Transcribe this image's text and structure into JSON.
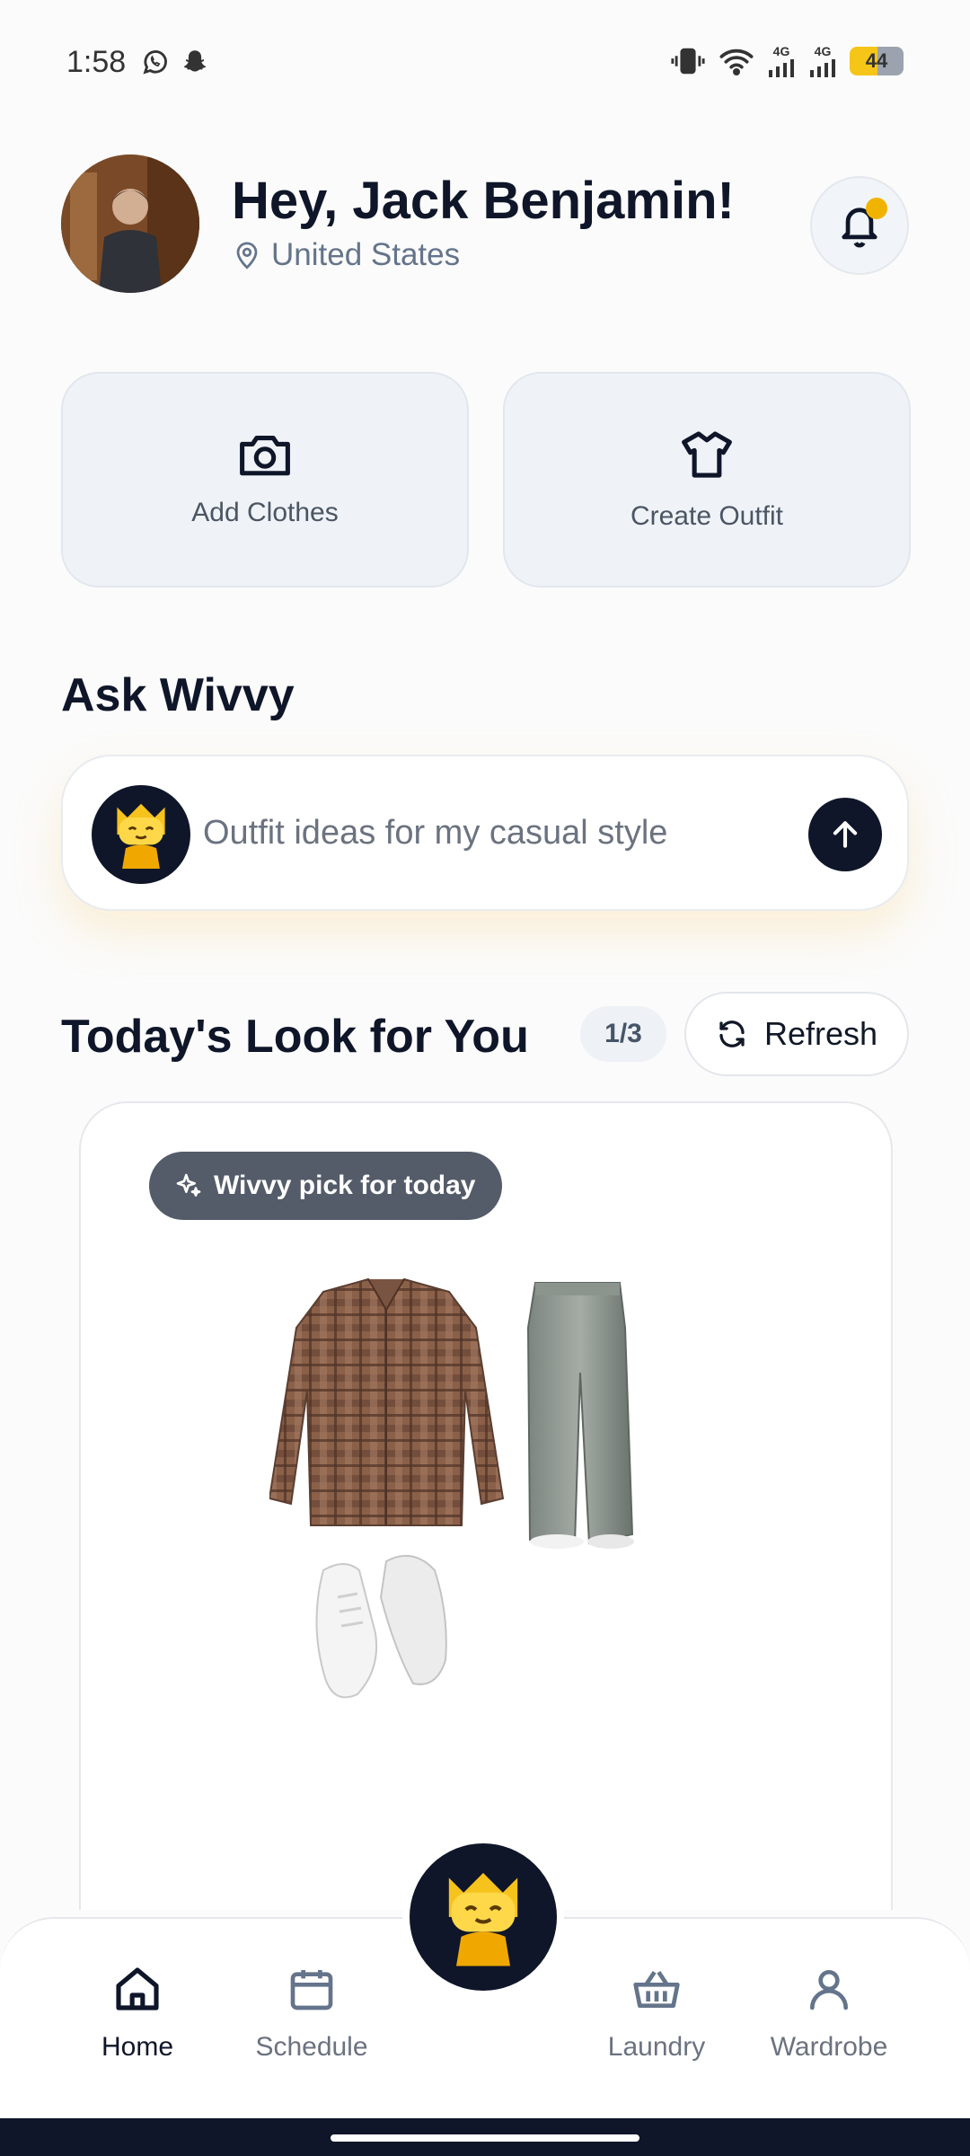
{
  "status_bar": {
    "time": "1:58",
    "left_icons": [
      "whatsapp-icon",
      "snapchat-icon"
    ],
    "right_icons": [
      "vibrate-icon",
      "wifi-icon",
      "signal-4g-icon",
      "signal-4g-icon"
    ],
    "network_1": "4G",
    "network_2": "4G",
    "battery_level": "44"
  },
  "header": {
    "greeting": "Hey, Jack Benjamin!",
    "location": "United States",
    "notification_dot_color": "#f0b400"
  },
  "actions": [
    {
      "label": "Add Clothes",
      "icon": "camera-icon"
    },
    {
      "label": "Create Outfit",
      "icon": "shirt-icon"
    }
  ],
  "ask": {
    "title": "Ask Wivvy",
    "placeholder": "Outfit ideas for my casual style"
  },
  "todays_look": {
    "title": "Today's Look for You",
    "counter": "1/3",
    "refresh_label": "Refresh",
    "pick_label": "Wivvy pick for today",
    "items": [
      "plaid-shirt",
      "grey-wide-leg-jeans",
      "white-sneakers"
    ]
  },
  "nav": {
    "items": [
      {
        "label": "Home",
        "icon": "home-icon",
        "active": true
      },
      {
        "label": "Schedule",
        "icon": "calendar-icon",
        "active": false
      },
      {
        "label": "Laundry",
        "icon": "basket-icon",
        "active": false
      },
      {
        "label": "Wardrobe",
        "icon": "person-icon",
        "active": false
      }
    ]
  },
  "colors": {
    "primary_dark": "#0f1629",
    "accent_yellow": "#f0b400",
    "card_bg": "#eff3f8",
    "muted_text": "#64748b"
  }
}
